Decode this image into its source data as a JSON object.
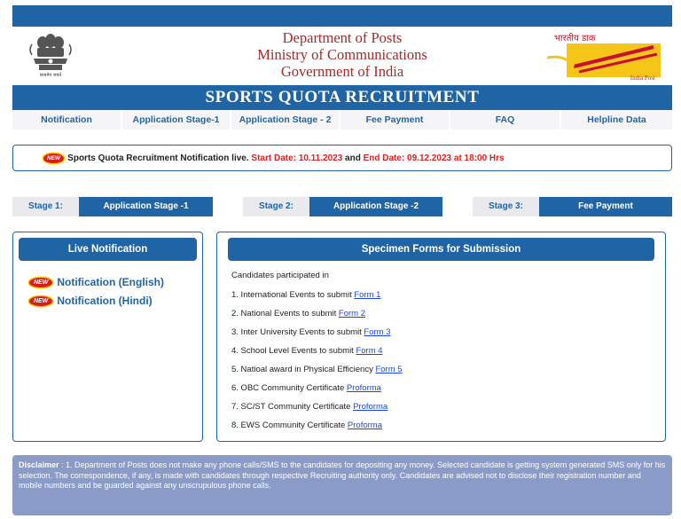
{
  "header": {
    "dept_line1": "Department of Posts",
    "dept_line2": "Ministry of Communications",
    "dept_line3": "Government of India",
    "emblem_caption": "सत्यमेव जयते",
    "logo_hindi": "भारतीय डाक",
    "logo_english": "India Post",
    "emblem_icon": "ashoka-emblem-icon",
    "logo_icon": "india-post-logo-icon"
  },
  "title": "SPORTS QUOTA RECRUITMENT",
  "nav": {
    "items": [
      {
        "label": "Notification"
      },
      {
        "label": "Application Stage-1"
      },
      {
        "label": "Application Stage - 2"
      },
      {
        "label": "Fee Payment"
      },
      {
        "label": "FAQ"
      },
      {
        "label": "Helpline Data"
      }
    ]
  },
  "announcement": {
    "badge": "NEW",
    "text": "Sports Quota Recruitment Notification live.",
    "start": "Start Date: 10.11.2023",
    "and": "and",
    "end": "End Date: 09.12.2023 at 18:00 Hrs"
  },
  "stages": [
    {
      "label": "Stage 1:",
      "button": "Application Stage -1"
    },
    {
      "label": "Stage 2:",
      "button": "Application Stage -2"
    },
    {
      "label": "Stage 3:",
      "button": "Fee Payment"
    }
  ],
  "live": {
    "title": "Live Notification",
    "badge": "NEW",
    "links": [
      "Notification (English)",
      "Notification (Hindi)"
    ]
  },
  "specimen": {
    "title": "Specimen Forms for Submission",
    "intro": "Candidates participated in",
    "items": [
      {
        "text": "1. International Events to submit ",
        "link": "Form 1"
      },
      {
        "text": "2. National Events to submit ",
        "link": "Form 2"
      },
      {
        "text": "3. Inter University Events to submit ",
        "link": "Form 3"
      },
      {
        "text": "4. School Level Events to submit ",
        "link": "Form 4"
      },
      {
        "text": "5. Natioal award in Physical Efficiency ",
        "link": "Form 5"
      },
      {
        "text": "6. OBC Community Certificate ",
        "link": "Proforma"
      },
      {
        "text": "7. SC/ST Community Certificate ",
        "link": "Proforma"
      },
      {
        "text": "8. EWS Community Certificate ",
        "link": "Proforma"
      }
    ]
  },
  "disclaimer": {
    "label": "Disclaimer",
    "text": " : 1. Department of Posts does not make any phone calls/SMS to the candidates for depositing any money. Selected candidate is getting system generated SMS only for his selection. The correspondence, if any, is made with candidates through respective Recruiting authority only. Candidates are advised not to disclose their registration number and mobile numbers and be guarded against any unscrupulous phone calls."
  },
  "colors": {
    "primary_blue": "#1f65a6",
    "dept_red": "#a52a2a",
    "alert_red": "#e02020",
    "link_blue": "#1a46e0",
    "disclaimer_bg": "#8a9bc7"
  }
}
